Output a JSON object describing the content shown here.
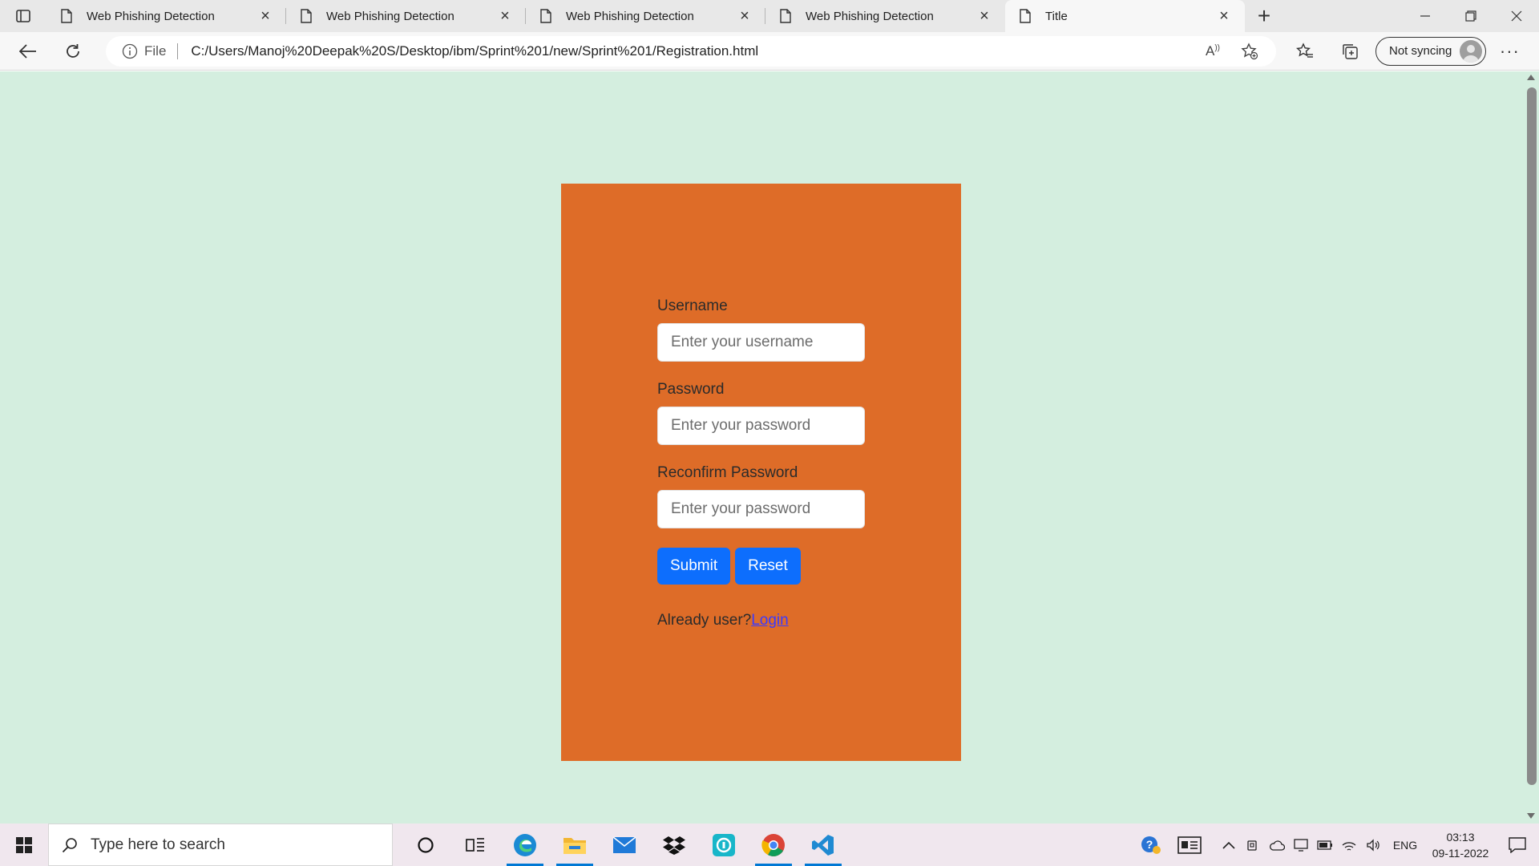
{
  "browser": {
    "tabs": [
      {
        "title": "Web Phishing Detection",
        "active": false
      },
      {
        "title": "Web Phishing Detection",
        "active": false
      },
      {
        "title": "Web Phishing Detection",
        "active": false
      },
      {
        "title": "Web Phishing Detection",
        "active": false
      },
      {
        "title": "Title",
        "active": true
      }
    ],
    "new_tab_label": "+",
    "address": {
      "scheme_label": "File",
      "url": "C:/Users/Manoj%20Deepak%20S/Desktop/ibm/Sprint%201/new/Sprint%201/Registration.html"
    },
    "profile_label": "Not syncing",
    "more_label": "···"
  },
  "page": {
    "background": "#d4eedf",
    "card_color": "#de6c28",
    "username_label": "Username",
    "username_placeholder": "Enter your username",
    "password_label": "Password",
    "password_placeholder": "Enter your password",
    "reconfirm_label": "Reconfirm Password",
    "reconfirm_placeholder": "Enter your password",
    "submit_label": "Submit",
    "reset_label": "Reset",
    "already_text": "Already user?",
    "login_link": "Login",
    "button_color": "#0d6efd"
  },
  "taskbar": {
    "search_placeholder": "Type here to search",
    "apps": [
      "cortana-icon",
      "task-view-icon",
      "edge-icon",
      "file-explorer-icon",
      "mail-icon",
      "dropbox-icon",
      "app-icon",
      "chrome-icon",
      "vscode-icon"
    ],
    "language": "ENG",
    "time": "03:13",
    "date": "09-11-2022"
  }
}
